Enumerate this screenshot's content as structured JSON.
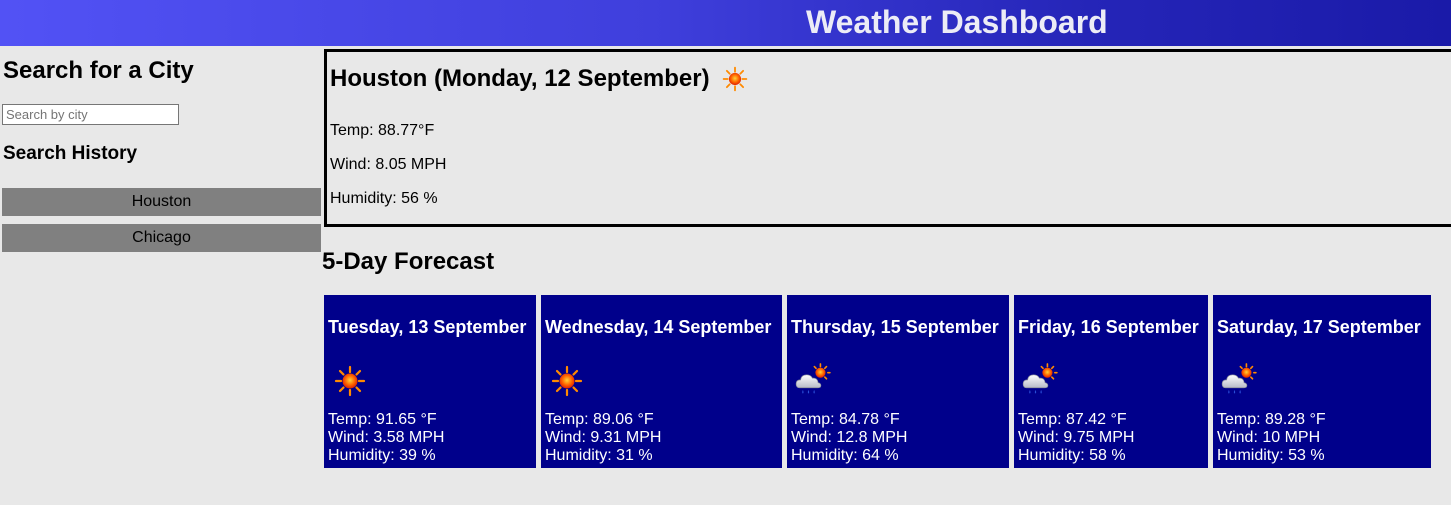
{
  "header": {
    "title": "Weather Dashboard"
  },
  "sidebar": {
    "title": "Search for a City",
    "search_placeholder": "Search by city",
    "search_value": "",
    "history_title": "Search History",
    "history": [
      {
        "label": "Houston"
      },
      {
        "label": "Chicago"
      }
    ]
  },
  "current": {
    "title": "Houston (Monday, 12 September)",
    "icon": "sun-icon",
    "temp": "Temp: 88.77°F",
    "wind": "Wind: 8.05 MPH",
    "humidity": "Humidity: 56 %"
  },
  "forecast": {
    "title": "5-Day Forecast",
    "days": [
      {
        "date": "Tuesday, 13 September",
        "icon": "sun-icon",
        "temp": "Temp: 91.65 °F",
        "wind": "Wind: 3.58 MPH",
        "humidity": "Humidity: 39 %"
      },
      {
        "date": "Wednesday, 14 September",
        "icon": "sun-icon",
        "temp": "Temp: 89.06 °F",
        "wind": "Wind: 9.31 MPH",
        "humidity": "Humidity: 31 %"
      },
      {
        "date": "Thursday, 15 September",
        "icon": "rain-sun-cloud-icon",
        "temp": "Temp: 84.78 °F",
        "wind": "Wind: 12.8 MPH",
        "humidity": "Humidity: 64 %"
      },
      {
        "date": "Friday, 16 September",
        "icon": "rain-sun-cloud-icon",
        "temp": "Temp: 87.42 °F",
        "wind": "Wind: 9.75 MPH",
        "humidity": "Humidity: 58 %"
      },
      {
        "date": "Saturday, 17 September",
        "icon": "rain-sun-cloud-icon",
        "temp": "Temp: 89.28 °F",
        "wind": "Wind: 10 MPH",
        "humidity": "Humidity: 53 %"
      }
    ]
  },
  "colors": {
    "header_gradient_start": "#5252f5",
    "header_gradient_end": "#1a1aa8",
    "card_background": "#00008b",
    "history_button": "#808080",
    "page_background": "#e8e8e8"
  }
}
